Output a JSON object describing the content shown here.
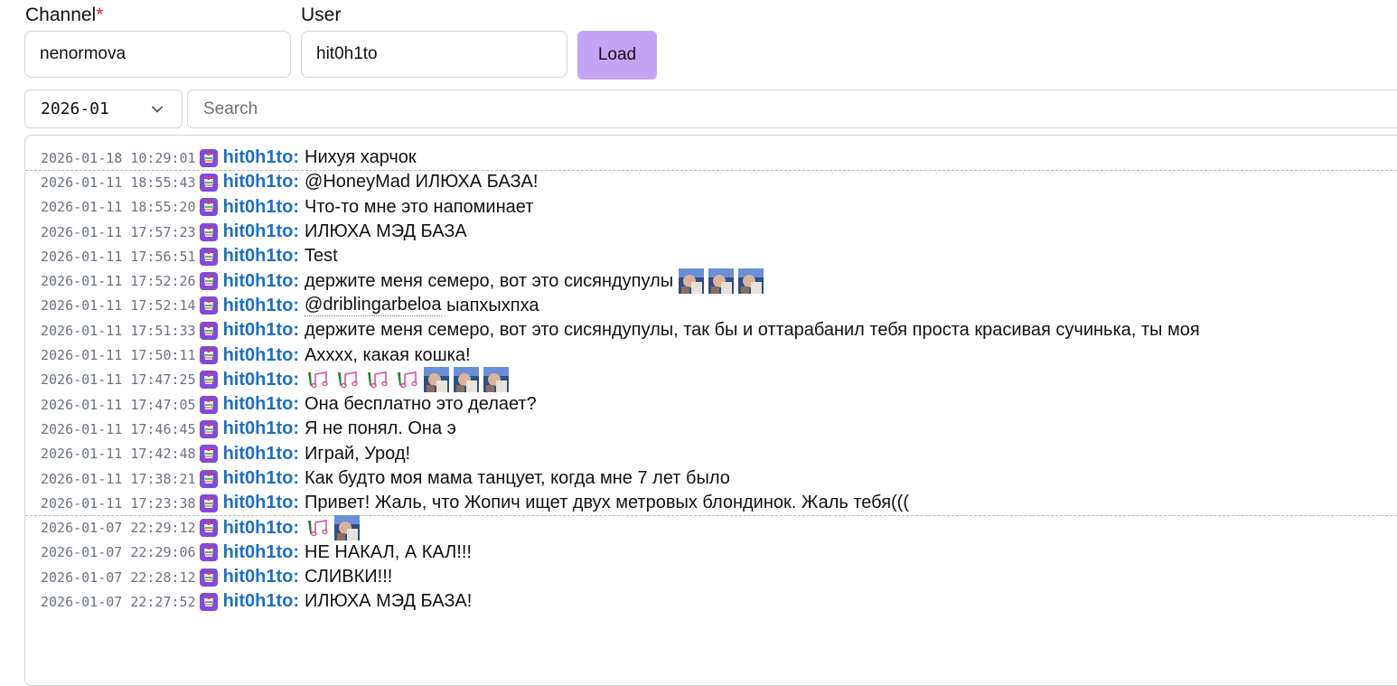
{
  "form": {
    "channel_label": "Channel",
    "channel_required_mark": "*",
    "channel_value": "nenormova",
    "user_label": "User",
    "user_value": "hit0h1to",
    "load_label": "Load"
  },
  "filters": {
    "month_value": "2026-01",
    "search_placeholder": "Search"
  },
  "colors": {
    "accent": "#c4a5f5",
    "username": "#1e6fc4",
    "timestamp": "#6b7280",
    "required": "#dc2626"
  },
  "messages": [
    {
      "time": "2026-01-18 10:29:01",
      "user": "hit0h1to:",
      "text": "Нихуя харчок",
      "day_end": true
    },
    {
      "time": "2026-01-11 18:55:43",
      "user": "hit0h1to:",
      "text": "@HoneyMad ИЛЮХА БАЗА!"
    },
    {
      "time": "2026-01-11 18:55:20",
      "user": "hit0h1to:",
      "text": "Что-то мне это напоминает"
    },
    {
      "time": "2026-01-11 17:57:23",
      "user": "hit0h1to:",
      "text": "ИЛЮХА МЭД БАЗА"
    },
    {
      "time": "2026-01-11 17:56:51",
      "user": "hit0h1to:",
      "text": "Test"
    },
    {
      "time": "2026-01-11 17:52:26",
      "user": "hit0h1to:",
      "text": "держите меня семеро, вот это сисяндупулы",
      "emotes": [
        "face-emote",
        "face-emote",
        "face-emote"
      ]
    },
    {
      "time": "2026-01-11 17:52:14",
      "user": "hit0h1to:",
      "mention": "@driblingarbeloa",
      "text": " ыапхыхпха"
    },
    {
      "time": "2026-01-11 17:51:33",
      "user": "hit0h1to:",
      "text": "держите меня семеро, вот это сисяндупулы, так бы и оттарабанил тебя проста красивая сучинька, ты моя"
    },
    {
      "time": "2026-01-11 17:50:11",
      "user": "hit0h1to:",
      "text": "Ахххх, какая кошка!"
    },
    {
      "time": "2026-01-11 17:47:25",
      "user": "hit0h1to:",
      "text": "",
      "emotes": [
        "music-emote",
        "music-emote",
        "music-emote",
        "music-emote",
        "face-emote",
        "face-emote",
        "face-emote"
      ]
    },
    {
      "time": "2026-01-11 17:47:05",
      "user": "hit0h1to:",
      "text": "Она бесплатно это делает?"
    },
    {
      "time": "2026-01-11 17:46:45",
      "user": "hit0h1to:",
      "text": "Я не понял. Она э"
    },
    {
      "time": "2026-01-11 17:42:48",
      "user": "hit0h1to:",
      "text": "Играй, Урод!"
    },
    {
      "time": "2026-01-11 17:38:21",
      "user": "hit0h1to:",
      "text": "Как будто моя мама танцует, когда мне 7 лет было"
    },
    {
      "time": "2026-01-11 17:23:38",
      "user": "hit0h1to:",
      "text": "Привет! Жаль, что Жопич ищет двух метровых блондинок. Жаль тебя(((",
      "day_end": true
    },
    {
      "time": "2026-01-07 22:29:12",
      "user": "hit0h1to:",
      "text": "",
      "emotes": [
        "music-emote",
        "face-emote"
      ]
    },
    {
      "time": "2026-01-07 22:29:06",
      "user": "hit0h1to:",
      "text": "НЕ НАКАЛ, А КАЛ!!!"
    },
    {
      "time": "2026-01-07 22:28:12",
      "user": "hit0h1to:",
      "text": "СЛИВКИ!!!"
    },
    {
      "time": "2026-01-07 22:27:52",
      "user": "hit0h1to:",
      "text": "ИЛЮХА МЭД БАЗА!"
    }
  ]
}
